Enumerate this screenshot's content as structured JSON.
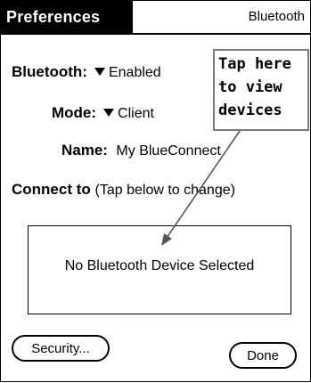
{
  "titlebar": {
    "app_title": "Preferences",
    "panel_picker": "Bluetooth"
  },
  "form": {
    "bluetooth_label": "Bluetooth:",
    "bluetooth_value": "Enabled",
    "mode_label": "Mode:",
    "mode_value": "Client",
    "name_label": "Name:",
    "name_value": "My BlueConnect",
    "connect_label": "Connect to",
    "connect_hint": "(Tap below to change)"
  },
  "callout": {
    "text": "Tap here\nto view\ndevices"
  },
  "device_box": {
    "text": "No Bluetooth Device Selected"
  },
  "buttons": {
    "security": "Security...",
    "done": "Done"
  },
  "colors": {
    "titlebar_bg": "#000000",
    "callout_border": "#7a7a7a"
  }
}
